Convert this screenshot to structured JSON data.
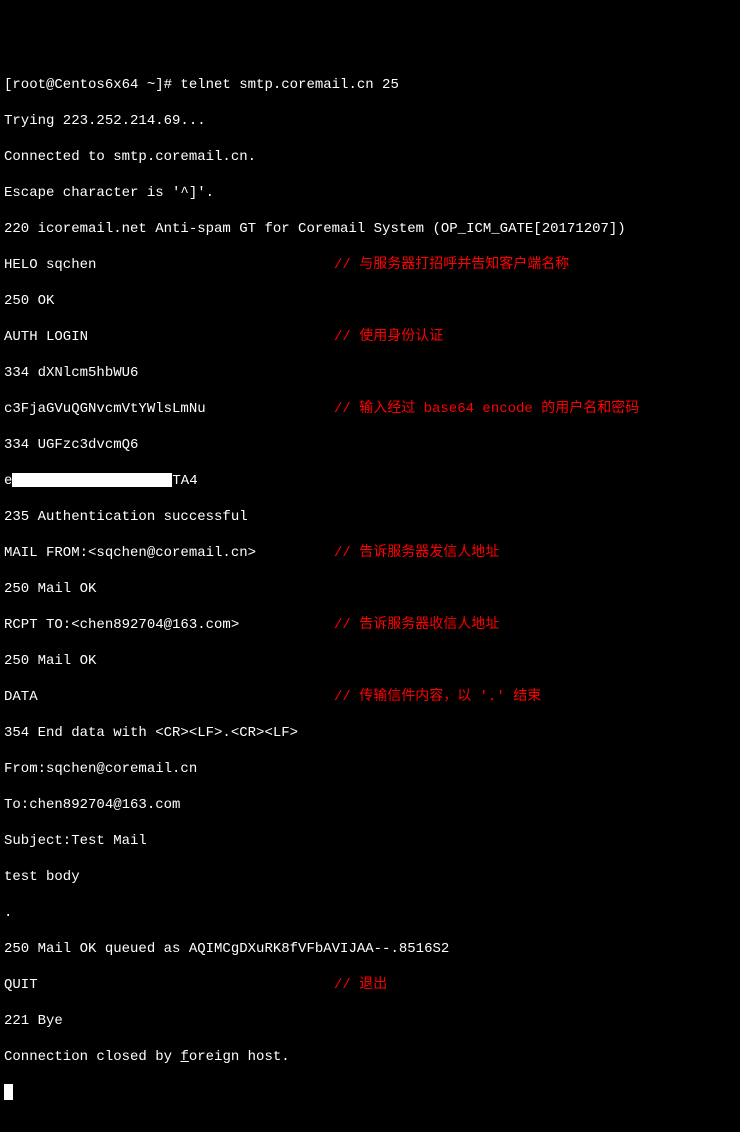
{
  "lines": {
    "l0_prompt": "[root@Centos6x64 ~]# telnet smtp.coremail.cn 25",
    "l1": "Trying 223.252.214.69...",
    "l2": "Connected to smtp.coremail.cn.",
    "l3": "Escape character is '^]'.",
    "l4": "220 icoremail.net Anti-spam GT for Coremail System (OP_ICM_GATE[20171207])",
    "l5": "HELO sqchen",
    "l5c": "// 与服务器打招呼并告知客户端名称",
    "l6": "250 OK",
    "l7": "AUTH LOGIN",
    "l7c": "// 使用身份认证",
    "l8": "334 dXNlcm5hbWU6",
    "l9": "c3FjaGVuQGNvcmVtYWlsLmNu",
    "l9c": "// 输入经过 base64 encode 的用户名和密码",
    "l10": "334 UGFzc3dvcmQ6",
    "l11a": "e",
    "l11b": "TA4",
    "l12": "235 Authentication successful",
    "l13": "MAIL FROM:<sqchen@coremail.cn>",
    "l13c": "// 告诉服务器发信人地址",
    "l14": "250 Mail OK",
    "l15": "RCPT TO:<chen892704@163.com>",
    "l15c": "// 告诉服务器收信人地址",
    "l16": "250 Mail OK",
    "l17": "DATA",
    "l17c": "// 传输信件内容，以 '.' 结束",
    "l18": "354 End data with <CR><LF>.<CR><LF>",
    "l19": "From:sqchen@coremail.cn",
    "l20": "To:chen892704@163.com",
    "l21": "Subject:Test Mail",
    "l22": "test body",
    "l23": ".",
    "l24": "250 Mail OK queued as AQIMCgDXuRK8fVFbAVIJAA--.8516S2",
    "l25": "QUIT",
    "l25c": "// 退出",
    "l26": "221 Bye",
    "l27a": "Connection closed by ",
    "l27b": "f",
    "l27c": "oreign host."
  }
}
